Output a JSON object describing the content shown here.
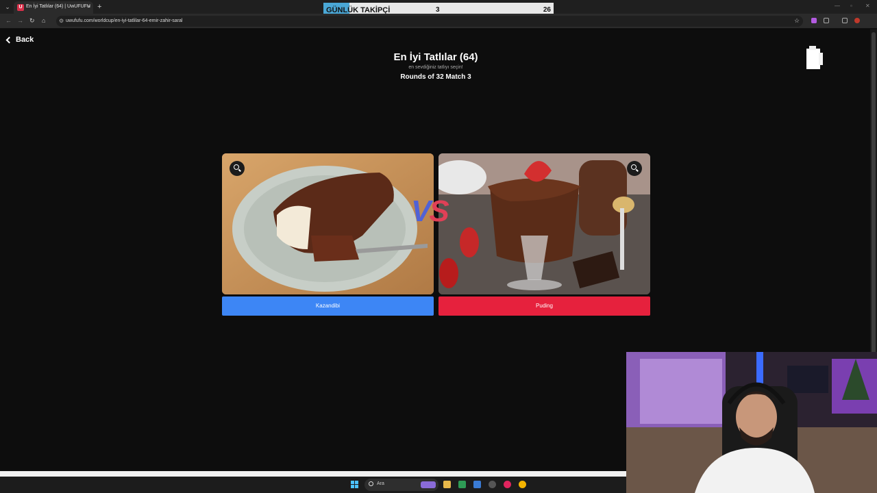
{
  "browser": {
    "tab_title": "En İyi Tatlılar (64) | UwUFUFU",
    "favicon_letter": "U",
    "url": "uwufufu.com/worldcup/en-iyi-tatlilar-64-emir-zahir-saral",
    "new_tab_label": "+",
    "close_label": "×"
  },
  "overlay_ticker": {
    "label": "GÜNLÜK TAKİPÇİ",
    "current": "3",
    "goal": "26"
  },
  "page": {
    "back_label": "Back",
    "title": "En İyi Tatlılar (64)",
    "subtitle": "en sevdiğiniz tatlıyı seçin!",
    "round": "Rounds of 32 Match 3",
    "vs_v": "V",
    "vs_s": "S"
  },
  "choices": [
    {
      "label": "Kazandibi",
      "color": "#3d86f5"
    },
    {
      "label": "Puding",
      "color": "#e6213d"
    }
  ],
  "taskbar": {
    "search_placeholder": "Ara"
  },
  "colors": {
    "background": "#0d0d0d",
    "blue": "#3d86f5",
    "red": "#e6213d"
  }
}
